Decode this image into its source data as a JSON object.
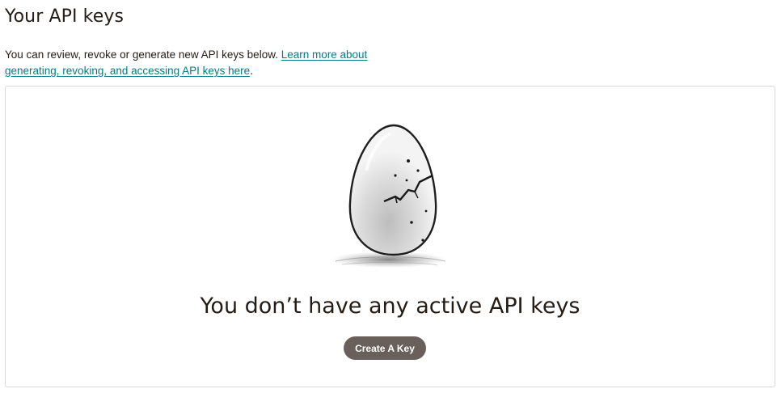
{
  "header": {
    "title": "Your API keys"
  },
  "intro": {
    "text": "You can review, revoke or generate new API keys below. ",
    "link_text": "Learn more about generating, revoking, and accessing API keys here",
    "trailing": "."
  },
  "empty_state": {
    "illustration": "cracked-egg",
    "message": "You don’t have any active API keys",
    "button_label": "Create A Key"
  },
  "colors": {
    "link": "#007c89",
    "button": "#6a605b",
    "text": "#241c15",
    "border": "#d9d9d9"
  }
}
